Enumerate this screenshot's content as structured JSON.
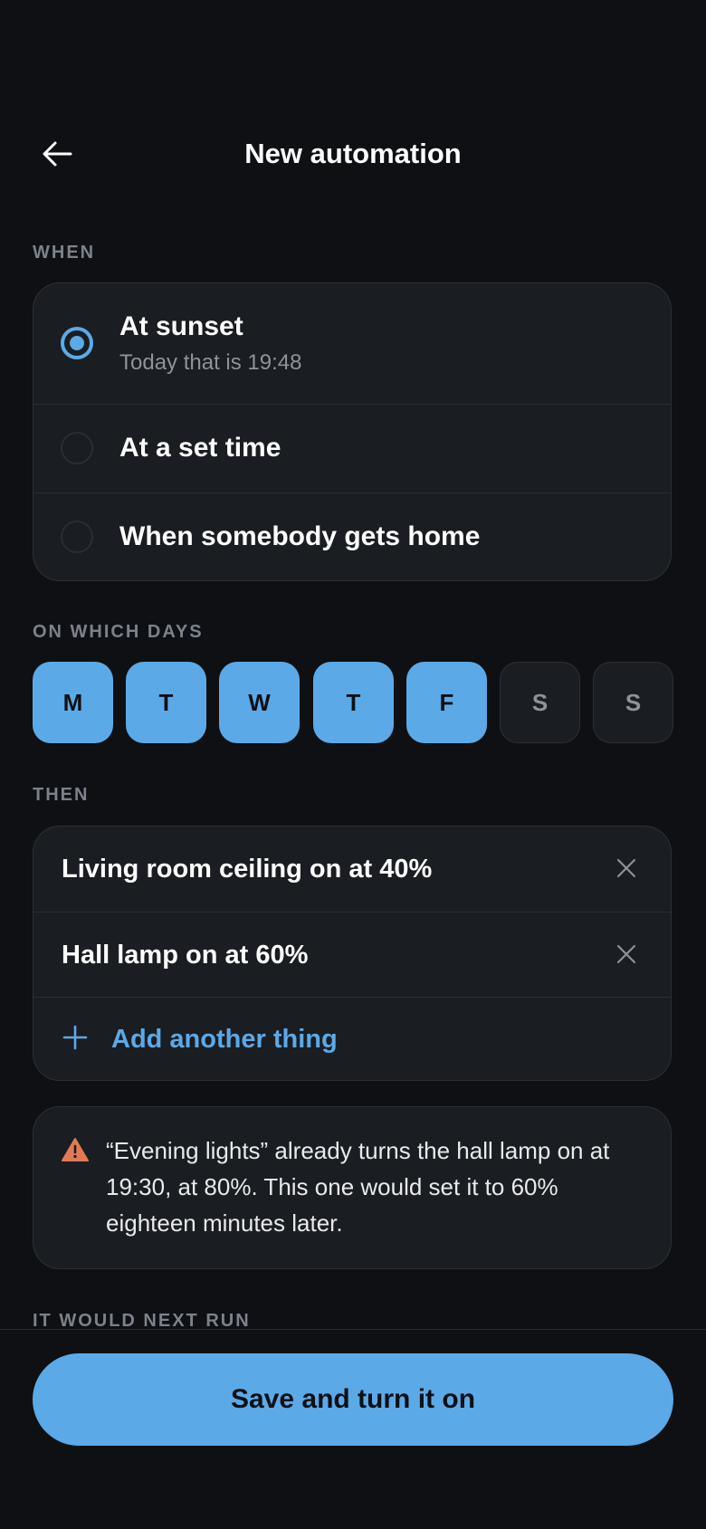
{
  "header": {
    "title": "New automation",
    "back_icon": "arrow-left-icon"
  },
  "when": {
    "label": "WHEN",
    "options": [
      {
        "label": "At sunset",
        "sublabel": "Today that is 19:48",
        "selected": true
      },
      {
        "label": "At a set time",
        "selected": false
      },
      {
        "label": "When somebody gets home",
        "selected": false
      }
    ]
  },
  "days": {
    "label": "ON WHICH DAYS",
    "items": [
      {
        "label": "M",
        "selected": true
      },
      {
        "label": "T",
        "selected": true
      },
      {
        "label": "W",
        "selected": true
      },
      {
        "label": "T",
        "selected": true
      },
      {
        "label": "F",
        "selected": true
      },
      {
        "label": "S",
        "selected": false
      },
      {
        "label": "S",
        "selected": false
      }
    ]
  },
  "then": {
    "label": "THEN",
    "actions": [
      {
        "text": "Living room ceiling on at 40%",
        "remove_icon": "close-icon"
      },
      {
        "text": "Hall lamp on at 60%",
        "remove_icon": "close-icon"
      }
    ],
    "add_label": "Add another thing",
    "add_icon": "plus-icon"
  },
  "warning": {
    "icon": "warning-icon",
    "text": "“Evening lights” already turns the hall lamp on at 19:30, at 80%. This one would set it to 60% eighteen minutes later."
  },
  "next_run": {
    "label": "IT WOULD NEXT RUN"
  },
  "footer": {
    "save_label": "Save and turn it on"
  },
  "colors": {
    "background": "#0e1014",
    "card": "#1a1d21",
    "accent": "#5ca9e8",
    "warning": "#e07a55",
    "muted": "#7c828c"
  }
}
